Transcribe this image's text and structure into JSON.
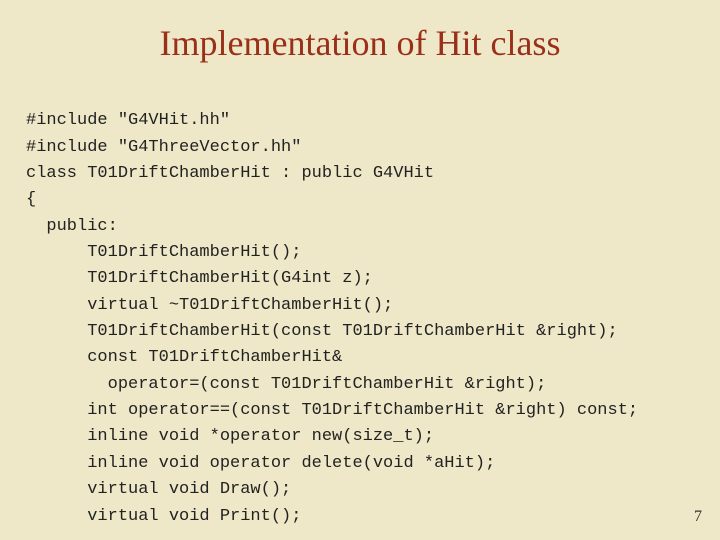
{
  "title": "Implementation of Hit class",
  "code_lines": [
    "#include \"G4VHit.hh\"",
    "#include \"G4ThreeVector.hh\"",
    "class T01DriftChamberHit : public G4VHit",
    "{",
    "  public:",
    "      T01DriftChamberHit();",
    "      T01DriftChamberHit(G4int z);",
    "      virtual ~T01DriftChamberHit();",
    "      T01DriftChamberHit(const T01DriftChamberHit &right);",
    "      const T01DriftChamberHit&",
    "        operator=(const T01DriftChamberHit &right);",
    "      int operator==(const T01DriftChamberHit &right) const;",
    "      inline void *operator new(size_t);",
    "      inline void operator delete(void *aHit);",
    "      virtual void Draw();",
    "      virtual void Print();"
  ],
  "page_number": "7"
}
